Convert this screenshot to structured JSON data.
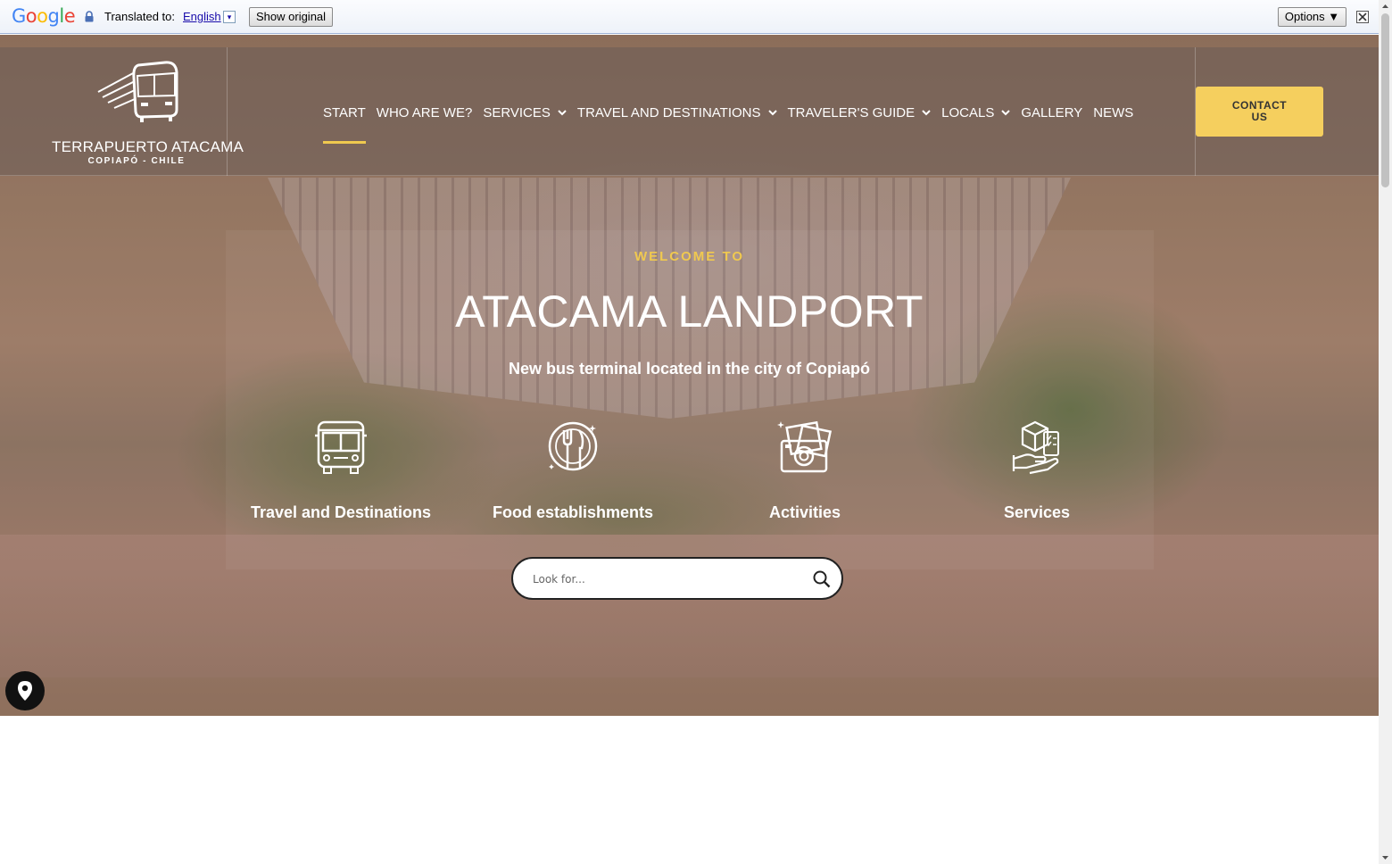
{
  "translate_bar": {
    "brand": "Google",
    "label": "Translated to:",
    "language": "English",
    "language_caret": "▾",
    "show_original": "Show original",
    "options": "Options ▼"
  },
  "header": {
    "logo_name": "TERRAPUERTO ATACAMA",
    "logo_sub": "COPIAPÓ - CHILE",
    "nav": [
      {
        "label": "START",
        "active": true,
        "dropdown": false
      },
      {
        "label": "WHO ARE WE?",
        "active": false,
        "dropdown": false
      },
      {
        "label": "SERVICES",
        "active": false,
        "dropdown": true
      },
      {
        "label": "TRAVEL AND DESTINATIONS",
        "active": false,
        "dropdown": true
      },
      {
        "label": "TRAVELER'S GUIDE",
        "active": false,
        "dropdown": true
      },
      {
        "label": "LOCALS",
        "active": false,
        "dropdown": true
      },
      {
        "label": "GALLERY",
        "active": false,
        "dropdown": false
      },
      {
        "label": "NEWS",
        "active": false,
        "dropdown": false
      }
    ],
    "contact_line1": "CONTACT",
    "contact_line2": "US"
  },
  "hero": {
    "welcome": "WELCOME TO",
    "title": "ATACAMA LANDPORT",
    "subtitle": "New bus terminal located in the city of Copiapó",
    "features": [
      {
        "label": "Travel and Destinations",
        "icon": "bus-icon"
      },
      {
        "label": "Food establishments",
        "icon": "fork-knife-plate-icon"
      },
      {
        "label": "Activities",
        "icon": "photos-camera-icon"
      },
      {
        "label": "Services",
        "icon": "hand-package-icon"
      }
    ],
    "search_placeholder": "Look for..."
  },
  "colors": {
    "accent": "#f0c94f",
    "contact_button": "#f5cf5e",
    "pin_button": "#111111"
  }
}
